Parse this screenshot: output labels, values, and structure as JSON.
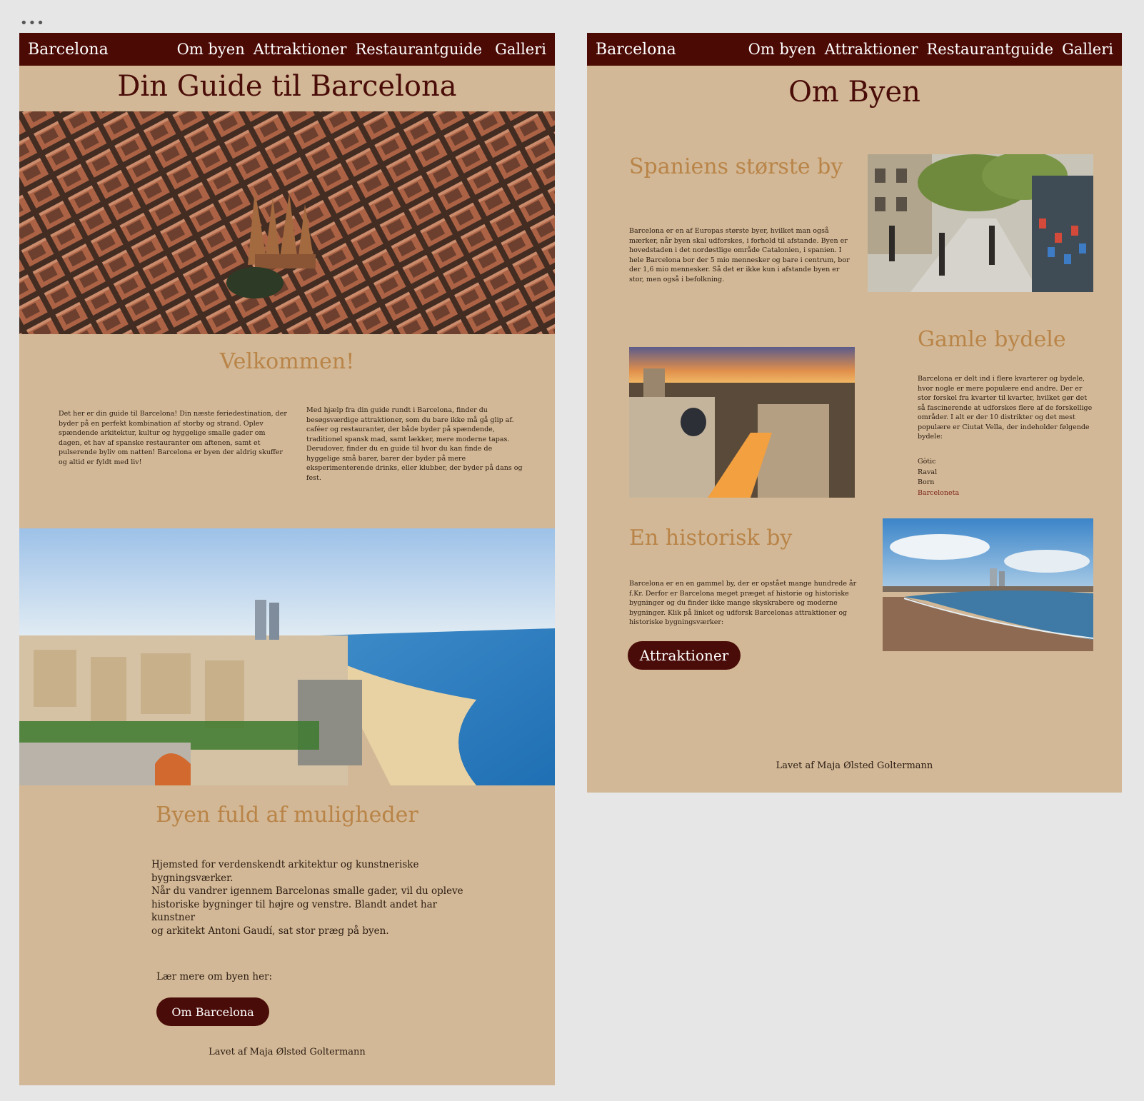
{
  "window": {
    "menu_dots": "•••"
  },
  "home": {
    "nav": {
      "brand": "Barcelona",
      "links": [
        "Om byen",
        "Attraktioner",
        "Restaurantguide",
        "Galleri"
      ]
    },
    "title": "Din Guide til Barcelona",
    "welcome_heading": "Velkommen!",
    "welcome_col1": "Det her er din guide til Barcelona! Din næste feriedestination, der byder på en perfekt kombination af storby og strand. Oplev spændende arkitektur, kultur og hyggelige smalle gader om dagen, et hav af spanske restauranter om aftenen, samt et pulserende byliv om natten! Barcelona er byen der aldrig skuffer og altid er fyldt med liv!",
    "welcome_col2": "Med hjælp fra din guide rundt i Barcelona, finder du besøgsværdige attraktioner, som du bare ikke må gå glip af. caféer og restauranter, der både byder på spændende, traditionel spansk mad, samt lækker, mere moderne tapas. Derudover, finder du en guide til hvor du kan finde de hyggelige små barer, barer der byder på mere eksperimenterende drinks, eller klubber, der byder på dans og fest.",
    "section2_heading": "Byen fuld af muligheder",
    "section2_lines": [
      "Hjemsted for verdenskendt arkitektur og kunstneriske bygningsværker.",
      "Når du vandrer igennem Barcelonas smalle gader, vil du opleve",
      "historiske bygninger til højre og venstre. Blandt andet har kunstner",
      "og arkitekt Antoni Gaudí, sat stor præg på byen."
    ],
    "learn_more": "Lær mere om byen her:",
    "button": "Om Barcelona",
    "footer": "Lavet af Maja Ølsted Goltermann"
  },
  "about": {
    "nav": {
      "brand": "Barcelona",
      "links": [
        "Om byen",
        "Attraktioner",
        "Restaurantguide",
        "Galleri"
      ]
    },
    "title": "Om Byen",
    "s1_heading": "Spaniens største by",
    "s1_text": "Barcelona er en af Europas største byer, hvilket man også mærker, når byen skal udforskes, i forhold til afstande. Byen er hovedstaden i det nordøstlige område Catalonien, i spanien. I hele Barcelona bor der 5 mio mennesker og bare i centrum, bor der 1,6 mio mennesker. Så det er ikke kun i afstande byen er stor, men også i befolkning.",
    "s2_heading": "Gamle bydele",
    "s2_text": "Barcelona er delt ind i flere kvarterer og bydele, hvor nogle er mere populære end andre. Der er stor forskel fra kvarter til kvarter, hvilket gør det så fascinerende at udforskes flere af de forskellige områder. I alt er der 10 distrikter og det mest populære er Ciutat Vella, der indeholder følgende bydele:",
    "s2_list": [
      "Gòtic",
      "Raval",
      "Born",
      "Barceloneta"
    ],
    "s3_heading": "En historisk by",
    "s3_text": "Barcelona er en en gammel by, der er opstået mange hundrede år f.Kr. Derfor er Barcelona meget præget af historie og historiske bygninger og du finder ikke mange skyskrabere og moderne bygninger. Klik på linket og udforsk Barcelonas attraktioner og historiske bygningsværker:",
    "button": "Attraktioner",
    "footer": "Lavet af Maja Ølsted Goltermann"
  },
  "colors": {
    "nav": "#4c0a05",
    "page_bg": "#d2b896",
    "title": "#4a0c08",
    "heading_gold": "#b98448"
  }
}
